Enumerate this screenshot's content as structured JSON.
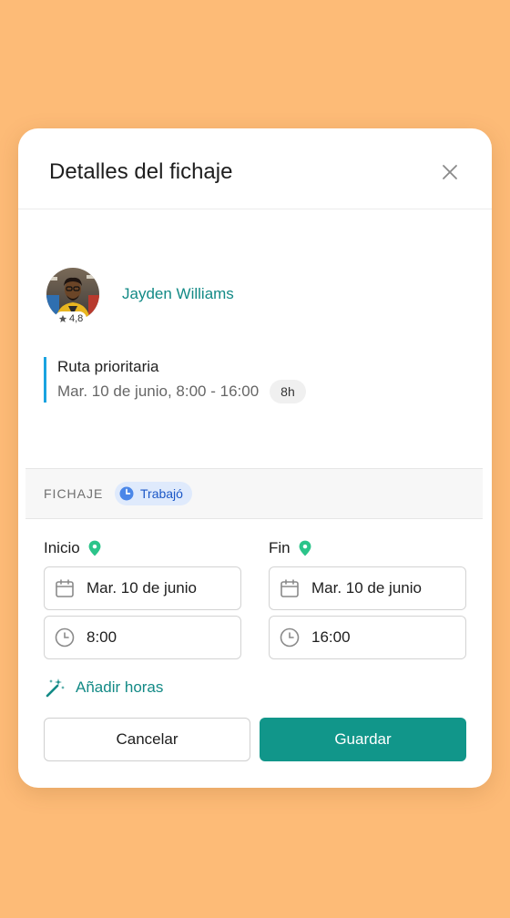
{
  "colors": {
    "page_background": "#FDBB77",
    "accent": "#138a86",
    "primary_button": "#11968a",
    "shift_bar": "#1aa3e0",
    "status_badge_bg": "#dfeafc",
    "status_badge_text": "#1b57c6",
    "location_pin": "#2bc48a"
  },
  "modal": {
    "title": "Detalles del fichaje",
    "close_icon": "close-icon"
  },
  "worker": {
    "name": "Jayden Williams",
    "rating": "4,8",
    "rating_icon": "star-icon"
  },
  "shift": {
    "name": "Ruta prioritaria",
    "time": "Mar. 10 de junio, 8:00 - 16:00",
    "hours": "8h"
  },
  "timesheet": {
    "section_label": "FICHAJE",
    "status": "Trabajó",
    "status_icon": "clock-icon"
  },
  "start": {
    "label": "Inicio",
    "date": "Mar. 10 de junio",
    "time": "8:00"
  },
  "end": {
    "label": "Fin",
    "date": "Mar. 10 de junio",
    "time": "16:00"
  },
  "add_hours": {
    "label": "Añadir horas",
    "icon": "magic-wand-icon"
  },
  "buttons": {
    "cancel": "Cancelar",
    "save": "Guardar"
  }
}
